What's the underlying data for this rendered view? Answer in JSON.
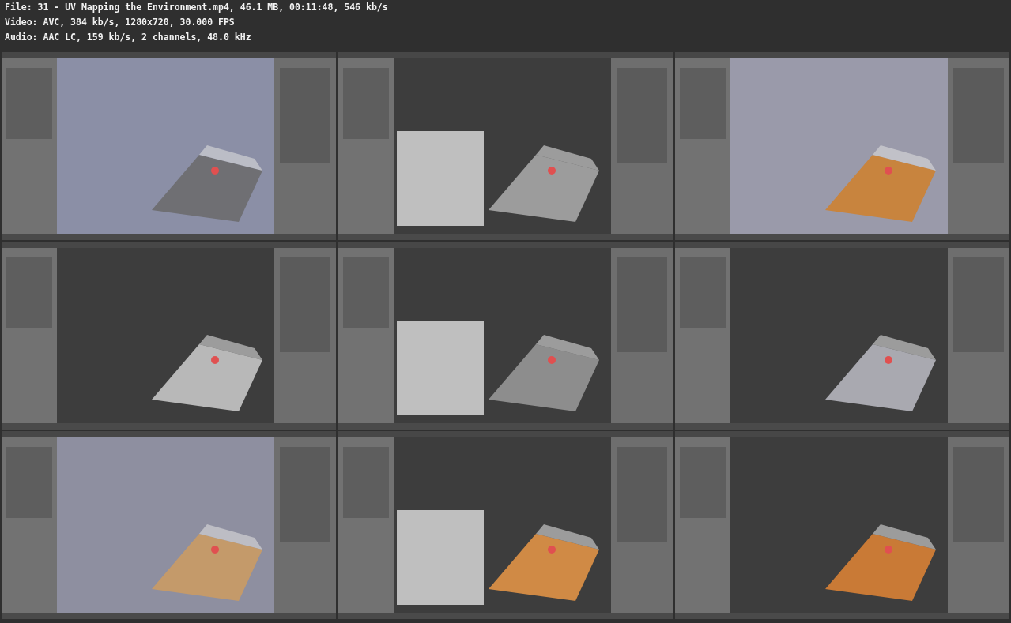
{
  "info_lines": [
    {
      "text": "File: 31 - UV Mapping the Environment.mp4, 46.1 MB, 00:11:48, 546 kb/s"
    },
    {
      "text": "Video: AVC, 384 kb/s, 1280x720, 30.000 FPS"
    },
    {
      "text": "Audio: AAC LC, 159 kb/s, 2 channels, 48.0 kHz"
    }
  ]
}
